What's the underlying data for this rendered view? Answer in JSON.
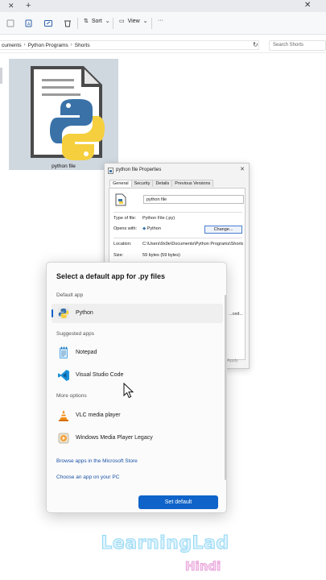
{
  "window": {
    "tab_close": "✕",
    "tab_add": "+",
    "controls": [
      "—",
      "▢",
      "✕"
    ]
  },
  "toolbar": {
    "sort_label": "Sort",
    "view_label": "View",
    "more_label": "···"
  },
  "address": {
    "crumbs": [
      "cuments",
      "Python Programs",
      "Shorts"
    ],
    "search_placeholder": "Search Shorts"
  },
  "file": {
    "name": "python file"
  },
  "properties": {
    "title": "python file Properties",
    "tabs": [
      "General",
      "Security",
      "Details",
      "Previous Versions"
    ],
    "file_name": "python file",
    "type_label": "Type of file:",
    "type_value": "Python File (.py)",
    "opens_label": "Opens with:",
    "opens_value": "Python",
    "change_label": "Change...",
    "location_label": "Location:",
    "location_value": "C:\\Users\\9x9e\\Documents\\Python Programs\\Shorts",
    "size_label": "Size:",
    "size_value": "59 bytes (59 bytes)",
    "advanced_label": "...ced...",
    "apply_label": "Apply"
  },
  "picker": {
    "title": "Select a default app for .py files",
    "default_section": "Default app",
    "default_apps": [
      {
        "label": "Python",
        "icon": "python-icon"
      }
    ],
    "suggested_section": "Suggested apps",
    "suggested_apps": [
      {
        "label": "Notepad",
        "icon": "notepad-icon"
      },
      {
        "label": "Visual Studio Code",
        "icon": "vscode-icon"
      }
    ],
    "more_section": "More options",
    "more_apps": [
      {
        "label": "VLC media player",
        "icon": "vlc-icon"
      },
      {
        "label": "Windows Media Player Legacy",
        "icon": "media-player-icon"
      }
    ],
    "store_link": "Browse apps in the Microsoft Store",
    "pc_link": "Choose an app on your PC",
    "set_default_label": "Set default"
  },
  "watermark": {
    "line1": "LearningLad",
    "line2": "Hindi"
  },
  "colors": {
    "accent": "#0f63c9",
    "link": "#1a52a8",
    "tile_bg": "#cfd7df"
  }
}
